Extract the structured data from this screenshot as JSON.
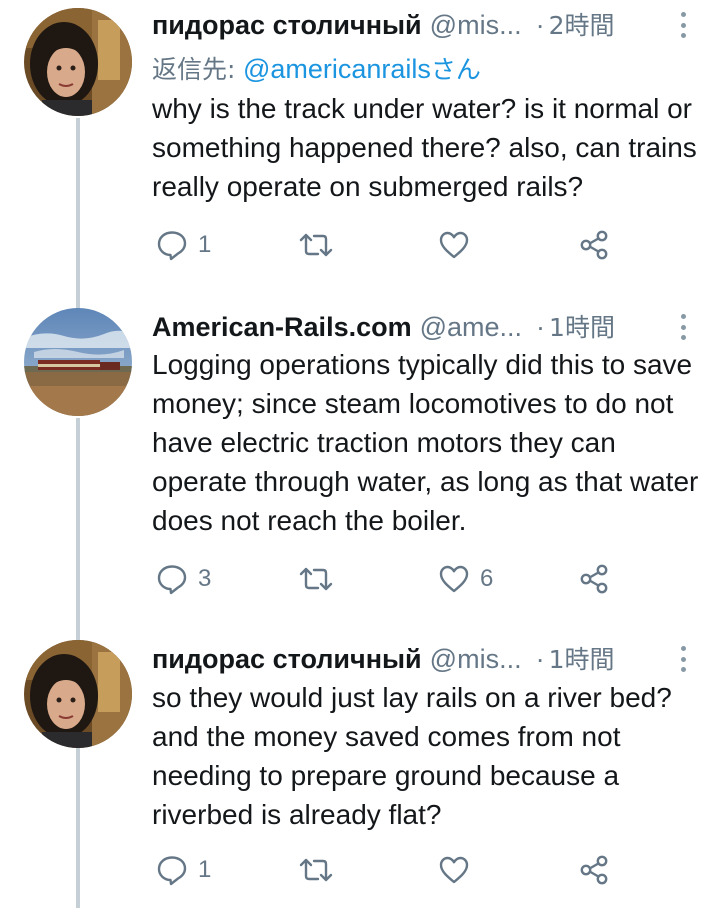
{
  "tweets": [
    {
      "display_name": "пидорас столичный",
      "handle": "@mis...",
      "separator": "·",
      "time": "2時間",
      "reply_label": "返信先:",
      "reply_mention": "@americanrails",
      "reply_suffix": "さん",
      "text": "why is the track under water? is it normal or something happened there? also, can trains really operate on submerged rails?",
      "reply_count": "1",
      "retweet_count": "",
      "like_count": ""
    },
    {
      "display_name": "American-Rails.com",
      "handle": "@ame...",
      "separator": "·",
      "time": "1時間",
      "text": "Logging operations typically did this to save money; since steam locomotives to do not have electric traction motors they can operate through water, as long as that water does not reach the boiler.",
      "reply_count": "3",
      "retweet_count": "",
      "like_count": "6"
    },
    {
      "display_name": "пидорас столичный",
      "handle": "@mis...",
      "separator": "·",
      "time": "1時間",
      "text": "so they would just lay rails on a river bed? and the money saved comes from not needing to prepare ground because a riverbed is already flat?",
      "reply_count": "1",
      "retweet_count": "",
      "like_count": ""
    }
  ],
  "icons": {
    "reply": "reply-icon",
    "retweet": "retweet-icon",
    "like": "heart-icon",
    "share": "share-icon",
    "more": "more-vertical-icon"
  },
  "colors": {
    "text": "#14171a",
    "secondary": "#657786",
    "link": "#1b95e0",
    "thread_line": "#c4cfd6",
    "icon": "#657786"
  }
}
